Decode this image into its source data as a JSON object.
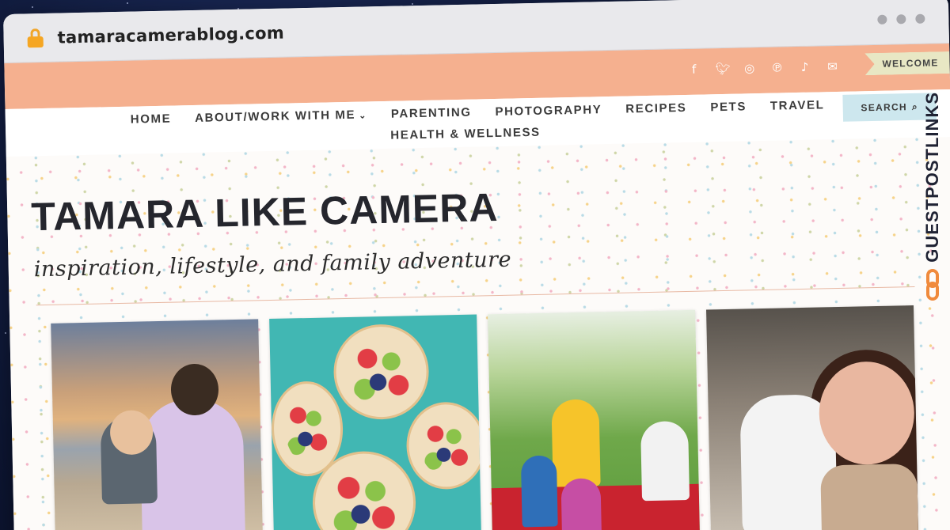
{
  "browser": {
    "url": "tamaracamerablog.com",
    "lock_icon": "lock-icon"
  },
  "topbar": {
    "social": [
      "facebook-icon",
      "twitter-icon",
      "instagram-icon",
      "pinterest-icon",
      "tiktok-icon",
      "email-icon"
    ],
    "welcome_label": "WELCOME"
  },
  "nav": {
    "items": [
      "HOME",
      "ABOUT/WORK WITH ME",
      "PARENTING",
      "PHOTOGRAPHY",
      "RECIPES",
      "PETS",
      "TRAVEL"
    ],
    "items_row2": [
      "HEALTH & WELLNESS"
    ],
    "search_label": "SEARCH"
  },
  "hero": {
    "title": "TAMARA LIKE CAMERA",
    "tagline": "inspiration, lifestyle, and family adventure"
  },
  "watermark": {
    "text": "GUESTPOSTLINKS"
  },
  "colors": {
    "topbar": "#f5b08f",
    "welcome_bg": "#e8e7c4",
    "search_bg": "#cde7ee",
    "title_text": "#25262d"
  }
}
